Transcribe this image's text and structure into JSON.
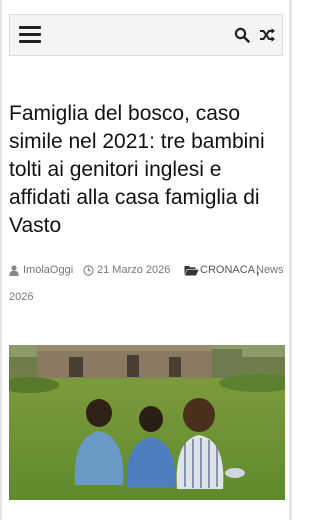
{
  "header": {
    "menu_icon": "hamburger-menu-icon",
    "search_icon": "search-icon",
    "random_icon": "shuffle-icon"
  },
  "article": {
    "title": "Famiglia del bosco, caso simile nel 2021: tre bambini tolti ai genitori inglesi e affidati alla casa famiglia di Vasto",
    "author": "ImolaOggi",
    "date": "21 Marzo 2026",
    "categories": [
      "CRONACA",
      "News"
    ],
    "category_separator": ",",
    "news_year": "2026"
  },
  "colors": {
    "topbar_bg": "#f4f4f4",
    "meta_text": "#777777",
    "title_text": "#111111"
  }
}
